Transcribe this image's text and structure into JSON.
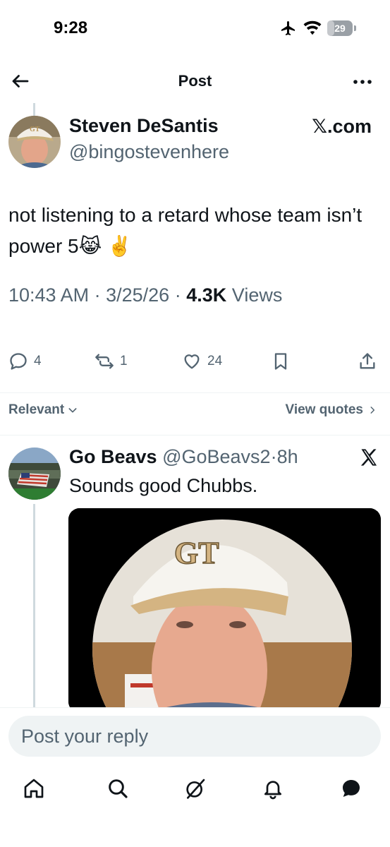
{
  "status_bar": {
    "time": "9:28",
    "battery": "29",
    "battery_level": 0.29
  },
  "header": {
    "title": "Post"
  },
  "post": {
    "author_name": "Steven DeSantis",
    "author_handle": "@bingostevenhere",
    "source": "𝕏.com",
    "text": "not listening to a retard whose team isn’t power 5😹 ✌️",
    "time": "10:43 AM",
    "sep1": "·",
    "date": "3/25/26",
    "sep2": "·",
    "views_count": "4.3K",
    "views_label": "Views",
    "reply_count": "4",
    "repost_count": "1",
    "like_count": "24"
  },
  "sort": {
    "label": "Relevant",
    "view_quotes": "View quotes"
  },
  "reply": {
    "name": "Go Beavs",
    "handle": "@GoBeavs2",
    "dot": "·",
    "time": "8h",
    "text": "Sounds good Chubbs."
  },
  "composer": {
    "placeholder": "Post your reply"
  },
  "tabs": [
    "home-icon",
    "search-icon",
    "grok-icon",
    "notifications-icon",
    "messages-icon"
  ],
  "colors": {
    "text": "#0f1419",
    "secondary": "#536471",
    "input_bg": "#eff3f4"
  }
}
